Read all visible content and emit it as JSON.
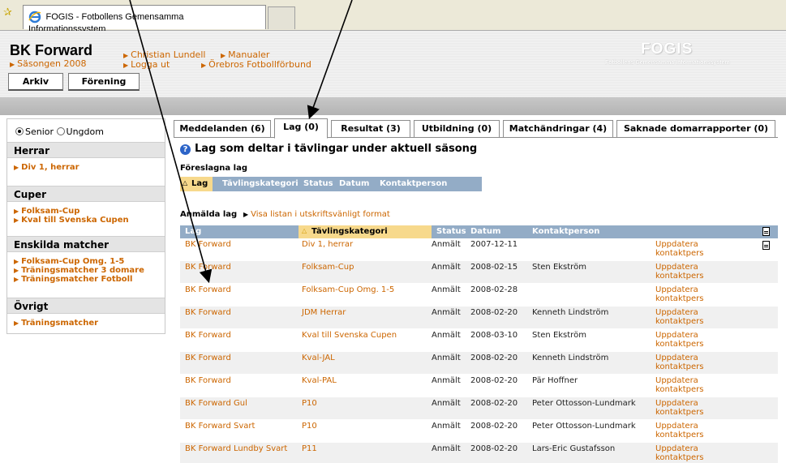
{
  "browser": {
    "tab_title": "FOGIS - Fotbollens Gemensamma Informationssystem"
  },
  "header": {
    "club_name": "BK Forward",
    "season": "Säsongen 2008",
    "links": {
      "user": "Christian Lundell",
      "manuals": "Manualer",
      "logout": "Logga ut",
      "federation": "Örebros Fotbollförbund"
    },
    "logo": "FOGIS",
    "logo_sub": "Fotbollens Gemensamma Informationssystem",
    "nav": [
      "Arkiv",
      "Förening"
    ]
  },
  "sidebar": {
    "radios": [
      {
        "label": "Senior",
        "selected": true
      },
      {
        "label": "Ungdom",
        "selected": false
      }
    ],
    "sections": [
      {
        "title": "Herrar",
        "links": [
          "Div 1, herrar"
        ]
      },
      {
        "title": "Cuper",
        "links": [
          "Folksam-Cup",
          "Kval till Svenska Cupen"
        ]
      },
      {
        "title": "Enskilda matcher",
        "links": [
          "Folksam-Cup Omg. 1-5",
          "Träningsmatcher 3 domare",
          "Träningsmatcher Fotboll"
        ]
      },
      {
        "title": "Övrigt",
        "links": [
          "Träningsmatcher"
        ]
      }
    ]
  },
  "tabs": [
    {
      "label": "Meddelanden (6)",
      "active": false
    },
    {
      "label": "Lag (0)",
      "active": true
    },
    {
      "label": "Resultat (3)",
      "active": false
    },
    {
      "label": "Utbildning (0)",
      "active": false
    },
    {
      "label": "Matchändringar (4)",
      "active": false
    },
    {
      "label": "Saknade domarrapporter (0)",
      "active": false
    }
  ],
  "main": {
    "title": "Lag som deltar i tävlingar under aktuell säsong",
    "suggested_label": "Föreslagna lag",
    "suggested_columns": [
      "Lag",
      "Tävlingskategori",
      "Status",
      "Datum",
      "Kontaktperson"
    ],
    "registered_label": "Anmälda lag",
    "print_link": "Visa listan i utskriftsvänligt format",
    "registered_columns": [
      "Lag",
      "Tävlingskategori",
      "Status",
      "Datum",
      "Kontaktperson"
    ],
    "rows": [
      {
        "lag": "BK Forward",
        "kategori": "Div 1, herrar",
        "status": "Anmält",
        "datum": "2007-12-11",
        "kontakt": "",
        "action": "Uppdatera kontaktpers"
      },
      {
        "lag": "BK Forward",
        "kategori": "Folksam-Cup",
        "status": "Anmält",
        "datum": "2008-02-15",
        "kontakt": "Sten Ekström",
        "action": "Uppdatera kontaktpers"
      },
      {
        "lag": "BK Forward",
        "kategori": "Folksam-Cup Omg. 1-5",
        "status": "Anmält",
        "datum": "2008-02-28",
        "kontakt": "",
        "action": "Uppdatera kontaktpers"
      },
      {
        "lag": "BK Forward",
        "kategori": "JDM Herrar",
        "status": "Anmält",
        "datum": "2008-02-20",
        "kontakt": "Kenneth Lindström",
        "action": "Uppdatera kontaktpers"
      },
      {
        "lag": "BK Forward",
        "kategori": "Kval till Svenska Cupen",
        "status": "Anmält",
        "datum": "2008-03-10",
        "kontakt": "Sten Ekström",
        "action": "Uppdatera kontaktpers"
      },
      {
        "lag": "BK Forward",
        "kategori": "Kval-JAL",
        "status": "Anmält",
        "datum": "2008-02-20",
        "kontakt": "Kenneth Lindström",
        "action": "Uppdatera kontaktpers"
      },
      {
        "lag": "BK Forward",
        "kategori": "Kval-PAL",
        "status": "Anmält",
        "datum": "2008-02-20",
        "kontakt": "Pär Hoffner",
        "action": "Uppdatera kontaktpers"
      },
      {
        "lag": "BK Forward Gul",
        "kategori": "P10",
        "status": "Anmält",
        "datum": "2008-02-20",
        "kontakt": "Peter Ottosson-Lundmark",
        "action": "Uppdatera kontaktpers"
      },
      {
        "lag": "BK Forward Svart",
        "kategori": "P10",
        "status": "Anmält",
        "datum": "2008-02-20",
        "kontakt": "Peter Ottosson-Lundmark",
        "action": "Uppdatera kontaktpers"
      },
      {
        "lag": "BK Forward Lundby Svart",
        "kategori": "P11",
        "status": "Anmält",
        "datum": "2008-02-20",
        "kontakt": "Lars-Eric Gustafsson",
        "action": "Uppdatera kontaktpers"
      }
    ]
  },
  "colors": {
    "link": "#cc6600",
    "table_header": "#93acc6",
    "sorted_column": "#f7d98c",
    "section_header": "#e4e4e4"
  },
  "icons": [
    "favorites-star-icon",
    "ie-page-icon",
    "help-icon",
    "pdf-icon",
    "triangle-bullet-icon"
  ]
}
